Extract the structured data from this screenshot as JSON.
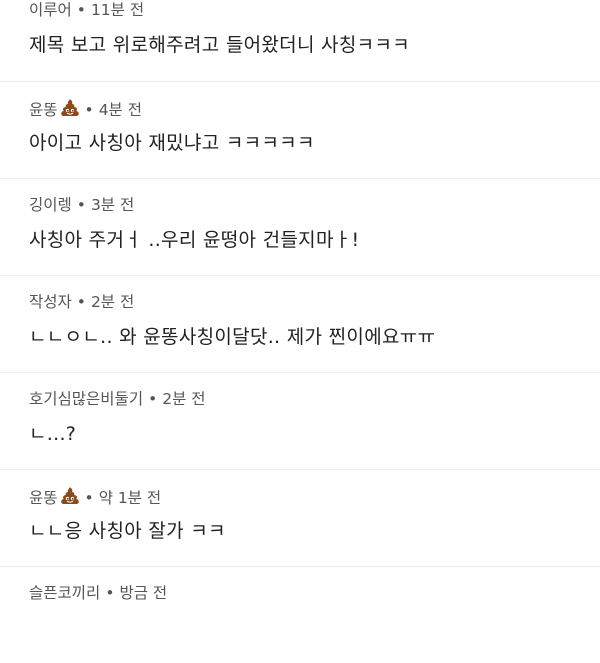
{
  "comments": [
    {
      "author": "이루어",
      "time": "11분 전",
      "text": "제목 보고 위로해주려고 들어왔더니 사칭ㅋㅋㅋ",
      "has_poop": false
    },
    {
      "author": "윤똥",
      "time": "4분 전",
      "text": "아이고 사칭아 재밌냐고 ㅋㅋㅋㅋㅋ",
      "has_poop": true
    },
    {
      "author": "깅이렝",
      "time": "3분 전",
      "text": "사칭아 주거ㅓ ..우리 윤떵아 건들지마ㅏ!",
      "has_poop": false
    },
    {
      "author": "작성자",
      "time": "2분 전",
      "text": "ㄴㄴㅇㄴ.. 와 윤똥사칭이달닷.. 제가 찐이에요ㅠㅠ",
      "has_poop": false
    },
    {
      "author": "호기심많은비둘기",
      "time": "2분 전",
      "text": "ㄴ...?",
      "has_poop": false
    },
    {
      "author": "윤똥",
      "time": "약 1분 전",
      "text": "ㄴㄴ응 사칭아 잘가 ㅋㅋ",
      "has_poop": true
    },
    {
      "author": "슬픈코끼리",
      "time": "방금 전",
      "text": "",
      "has_poop": false
    }
  ],
  "separator": "•",
  "icons": {
    "author_badge": "pile-of-poo-icon"
  },
  "colors": {
    "meta": "#555555",
    "body": "#222222",
    "divider": "#ececec",
    "poop": "#8b4a1c"
  }
}
